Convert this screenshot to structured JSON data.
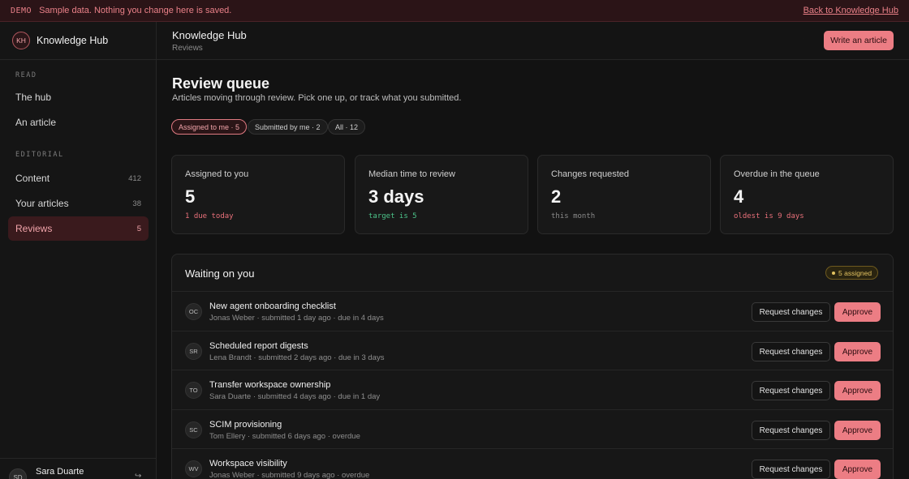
{
  "banner": {
    "tag": "DEMO",
    "message": "Sample data. Nothing you change here is saved.",
    "back_link": "Back to Knowledge Hub"
  },
  "sidebar": {
    "brand_initials": "KH",
    "brand_name": "Knowledge Hub",
    "sections": [
      {
        "label": "READ",
        "items": [
          {
            "label": "The hub"
          },
          {
            "label": "An article"
          }
        ]
      },
      {
        "label": "EDITORIAL",
        "items": [
          {
            "label": "Content",
            "count": "412"
          },
          {
            "label": "Your articles",
            "count": "38"
          },
          {
            "label": "Reviews",
            "count": "5",
            "active": true
          }
        ]
      }
    ],
    "user": {
      "initials": "SD",
      "name": "Sara Duarte",
      "action_icon": "sign-out-icon"
    }
  },
  "topbar": {
    "title": "Knowledge Hub",
    "breadcrumb": "Reviews",
    "theme_icon": "moon-icon",
    "write_button": "Write an article"
  },
  "page": {
    "title": "Review queue",
    "subtitle": "Articles moving through review. Pick one up, or track what you submitted.",
    "filters": [
      {
        "label": "Assigned to me · 5",
        "active": true
      },
      {
        "label": "Submitted by me · 2",
        "active": false
      },
      {
        "label": "All · 12",
        "active": false
      }
    ]
  },
  "stats": [
    {
      "label": "Assigned to you",
      "value": "5",
      "note": "1 due today",
      "note_color": "#e8707a"
    },
    {
      "label": "Median time to review",
      "value": "3 days",
      "note": "target is 5",
      "note_color": "#4cc48a"
    },
    {
      "label": "Changes requested",
      "value": "2",
      "note": "this month",
      "note_color": "#8a8a8a"
    },
    {
      "label": "Overdue in the queue",
      "value": "4",
      "note": "oldest is 9 days",
      "note_color": "#e8707a"
    }
  ],
  "queue": {
    "title": "Waiting on you",
    "badge": "5 assigned",
    "request_label": "Request changes",
    "approve_label": "Approve",
    "rows": [
      {
        "initials": "OC",
        "title": "New agent onboarding checklist",
        "meta": "Jonas Weber · submitted 1 day ago · due in 4 days"
      },
      {
        "initials": "SR",
        "title": "Scheduled report digests",
        "meta": "Lena Brandt · submitted 2 days ago · due in 3 days"
      },
      {
        "initials": "TO",
        "title": "Transfer workspace ownership",
        "meta": "Sara Duarte · submitted 4 days ago · due in 1 day"
      },
      {
        "initials": "SC",
        "title": "SCIM provisioning",
        "meta": "Tom Ellery · submitted 6 days ago · overdue"
      },
      {
        "initials": "WV",
        "title": "Workspace visibility",
        "meta": "Jonas Weber · submitted 9 days ago · overdue"
      }
    ]
  },
  "colors": {
    "accent": "#ec7d84",
    "warning": "#e2c260",
    "success": "#4cc48a"
  }
}
